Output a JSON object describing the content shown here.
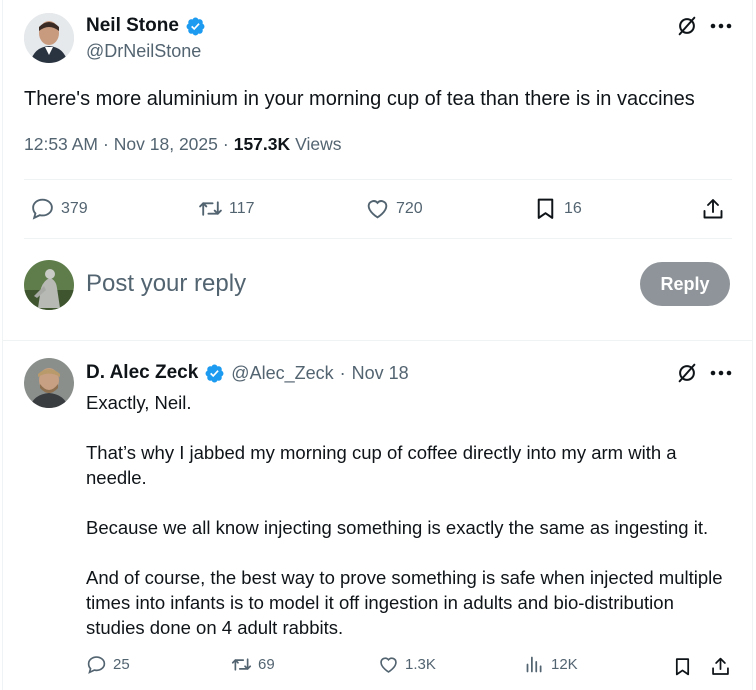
{
  "main_tweet": {
    "author_name": "Neil Stone",
    "author_handle": "@DrNeilStone",
    "text": "There's more aluminium in your morning cup of tea than there is in vaccines",
    "time": "12:53 AM",
    "date": "Nov 18, 2025",
    "views_count": "157.3K",
    "views_label": "Views",
    "metrics": {
      "replies": "379",
      "reposts": "117",
      "likes": "720",
      "bookmarks": "16"
    }
  },
  "composer": {
    "placeholder": "Post your reply",
    "reply_button": "Reply"
  },
  "reply_tweet": {
    "author_name": "D. Alec Zeck",
    "author_handle": "@Alec_Zeck",
    "date_separator": "·",
    "date": "Nov 18",
    "paragraphs": [
      "Exactly, Neil.",
      "That’s why I jabbed my morning cup of coffee directly into my arm with a needle.",
      "Because we all know injecting something is exactly the same as ingesting it.",
      "And of course, the best way to prove something is safe when injected multiple times into infants is to model it off ingestion in adults and bio-distribution studies done on 4 adult rabbits."
    ],
    "metrics": {
      "replies": "25",
      "reposts": "69",
      "likes": "1.3K",
      "views": "12K"
    }
  },
  "colors": {
    "verified": "#1d9bf0",
    "secondary_text": "#536471",
    "reply_button_disabled": "#8e9499",
    "divider": "#eff3f4"
  }
}
